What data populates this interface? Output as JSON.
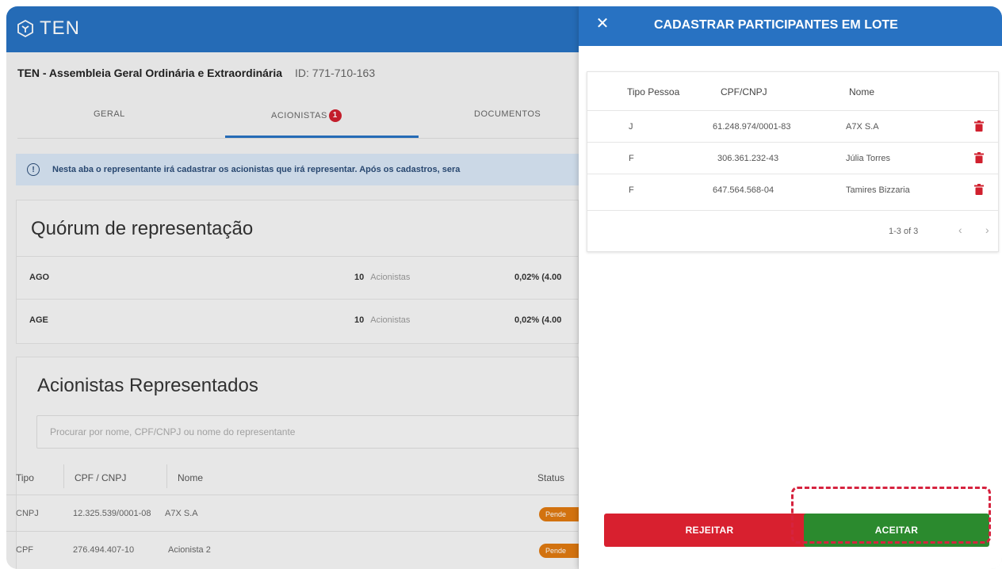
{
  "app": {
    "logo_text": "TEN"
  },
  "event": {
    "title": "TEN - Assembleia Geral Ordinária e Extraordinária",
    "id_label": "ID: 771-710-163"
  },
  "tabs": [
    {
      "label": "GERAL"
    },
    {
      "label": "ACIONISTAS",
      "badge": "1"
    },
    {
      "label": "DOCUMENTOS"
    }
  ],
  "info": {
    "text": "Nesta aba o representante irá cadastrar os acionistas que irá representar. Após os cadastros, sera"
  },
  "quorum": {
    "title": "Quórum de representação",
    "rows": [
      {
        "label": "AGO",
        "count": "10",
        "unit": "Acionistas",
        "pct": "0,02% (4.00"
      },
      {
        "label": "AGE",
        "count": "10",
        "unit": "Acionistas",
        "pct": "0,02% (4.00"
      }
    ]
  },
  "represented": {
    "title": "Acionistas Representados",
    "search_placeholder": "Procurar por nome, CPF/CNPJ ou nome do representante",
    "headers": [
      "Tipo",
      "CPF / CNPJ",
      "Nome",
      "Status"
    ],
    "rows": [
      {
        "tipo": "CNPJ",
        "doc": "12.325.539/0001-08",
        "nome": "A7X S.A",
        "status": "Pende"
      },
      {
        "tipo": "CPF",
        "doc": "276.494.407-10",
        "nome": "Acionista 2",
        "status": "Pende"
      }
    ]
  },
  "drawer": {
    "title": "CADASTRAR PARTICIPANTES EM LOTE",
    "close_icon": "close-icon",
    "headers": [
      "Tipo Pessoa",
      "CPF/CNPJ",
      "Nome"
    ],
    "rows": [
      {
        "tipo": "J",
        "doc": "61.248.974/0001-83",
        "nome": "A7X S.A"
      },
      {
        "tipo": "F",
        "doc": "306.361.232-43",
        "nome": "Júlia Torres"
      },
      {
        "tipo": "F",
        "doc": "647.564.568-04",
        "nome": "Tamires Bizzaria"
      }
    ],
    "pagination": "1-3 of 3",
    "reject_label": "REJEITAR",
    "accept_label": "ACEITAR"
  },
  "colors": {
    "header_blue": "#2872c2",
    "reject_red": "#d8202f",
    "accept_green": "#2b8a2e",
    "highlight": "#d6233f",
    "trash_red": "#d0202e"
  }
}
